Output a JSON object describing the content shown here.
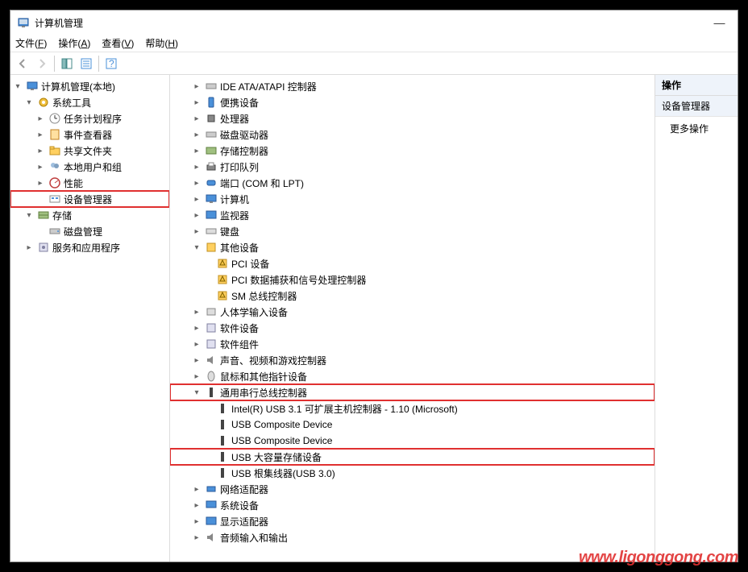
{
  "window": {
    "title": "计算机管理",
    "minimize": "—"
  },
  "menu": {
    "file": "文件(F)",
    "action": "操作(A)",
    "view": "查看(V)",
    "help": "帮助(H)"
  },
  "left_tree": {
    "root": "计算机管理(本地)",
    "system_tools": "系统工具",
    "task_scheduler": "任务计划程序",
    "event_viewer": "事件查看器",
    "shared_folders": "共享文件夹",
    "local_users": "本地用户和组",
    "performance": "性能",
    "device_manager": "设备管理器",
    "storage": "存储",
    "disk_mgmt": "磁盘管理",
    "services_apps": "服务和应用程序"
  },
  "mid_tree": {
    "ide": "IDE ATA/ATAPI 控制器",
    "portable": "便携设备",
    "processor": "处理器",
    "disk_drive": "磁盘驱动器",
    "storage_ctrl": "存储控制器",
    "printer": "打印队列",
    "ports": "端口 (COM 和 LPT)",
    "computer": "计算机",
    "monitor": "监视器",
    "keyboard": "键盘",
    "other": "其他设备",
    "pci_device": "PCI 设备",
    "pci_data": "PCI 数据捕获和信号处理控制器",
    "sm_bus": "SM 总线控制器",
    "hid": "人体学输入设备",
    "software_dev": "软件设备",
    "software_comp": "软件组件",
    "sound": "声音、视频和游戏控制器",
    "mouse": "鼠标和其他指针设备",
    "usb_ctrl": "通用串行总线控制器",
    "usb1": "Intel(R) USB 3.1 可扩展主机控制器 - 1.10 (Microsoft)",
    "usb2": "USB Composite Device",
    "usb3": "USB Composite Device",
    "usb4": "USB 大容量存储设备",
    "usb5": "USB 根集线器(USB 3.0)",
    "network": "网络适配器",
    "system_dev": "系统设备",
    "display": "显示适配器",
    "audio": "音频输入和输出"
  },
  "right": {
    "header": "操作",
    "sub": "设备管理器",
    "more": "更多操作"
  },
  "watermark": "www.ligonggong.com"
}
